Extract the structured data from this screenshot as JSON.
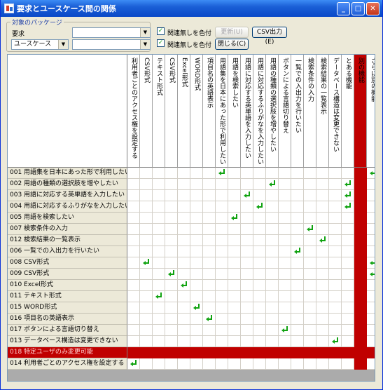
{
  "window": {
    "title": "要求とユースケース間の関係"
  },
  "filter": {
    "group_label": "対象のパッケージ",
    "req_label": "要求",
    "type_value": "ユースケース",
    "combo1_value": "",
    "combo2_value": ""
  },
  "options": {
    "chk1_label": "関連無しを色付",
    "chk2_label": "関連無しを色付",
    "chk1_checked": true,
    "chk2_checked": true
  },
  "buttons": {
    "update": "更新(U)",
    "csv": "CSV出力(E)",
    "close": "閉じる(C)"
  },
  "columns": [
    {
      "label": "利用者ごとのアクセス権を設定する",
      "red": false
    },
    {
      "label": "CSV形式",
      "red": false
    },
    {
      "label": "テキスト形式",
      "red": false
    },
    {
      "label": "CSV形式",
      "red": false
    },
    {
      "label": "Excel形式",
      "red": false
    },
    {
      "label": "WORD形式",
      "red": false
    },
    {
      "label": "項目名の英語表示",
      "red": false
    },
    {
      "label": "用語集を日本にあった形で利用したい",
      "red": false
    },
    {
      "label": "用語を検索したい",
      "red": false
    },
    {
      "label": "用語に対応する英単語を入力したい",
      "red": false
    },
    {
      "label": "用語に対応するふりがなを入力したい",
      "red": false
    },
    {
      "label": "用語の種類の選択肢を増やしたい",
      "red": false
    },
    {
      "label": "ボタンによる言語切り替え",
      "red": false
    },
    {
      "label": "一覧での入出力を行いたい",
      "red": false
    },
    {
      "label": "検索条件の入力",
      "red": false
    },
    {
      "label": "検索結果の一覧表示",
      "red": false
    },
    {
      "label": "データベース構造は変更できない",
      "red": false
    },
    {
      "label": "とある機能",
      "red": false
    },
    {
      "label": "別の機能",
      "red": true
    },
    {
      "label": "さらに別の機能",
      "red": false
    }
  ],
  "rows": [
    {
      "label": "001 用語集を日本にあった形で利用したい",
      "red": false,
      "marks": [
        7,
        19
      ]
    },
    {
      "label": "002 用語の種類の選択肢を増やしたい",
      "red": false,
      "marks": [
        11,
        17
      ]
    },
    {
      "label": "003 用語に対応する英単語を入力したい",
      "red": false,
      "marks": [
        9,
        17
      ]
    },
    {
      "label": "004 用語に対応するふりがなを入力したい",
      "red": false,
      "marks": [
        10,
        17
      ]
    },
    {
      "label": "005 用語を検索したい",
      "red": false,
      "marks": [
        8
      ]
    },
    {
      "label": "007 検索条件の入力",
      "red": false,
      "marks": [
        14
      ]
    },
    {
      "label": "012 検索結果の一覧表示",
      "red": false,
      "marks": [
        15
      ]
    },
    {
      "label": "006 一覧での入出力を行いたい",
      "red": false,
      "marks": [
        13
      ]
    },
    {
      "label": "008 CSV形式",
      "red": false,
      "marks": [
        1,
        19
      ]
    },
    {
      "label": "009 CSV形式",
      "red": false,
      "marks": [
        3,
        19
      ]
    },
    {
      "label": "010 Excel形式",
      "red": false,
      "marks": [
        4
      ]
    },
    {
      "label": "011 テキスト形式",
      "red": false,
      "marks": [
        2
      ]
    },
    {
      "label": "015 WORD形式",
      "red": false,
      "marks": [
        5
      ]
    },
    {
      "label": "016 項目名の英語表示",
      "red": false,
      "marks": [
        6
      ]
    },
    {
      "label": "017 ボタンによる言語切り替え",
      "red": false,
      "marks": [
        12
      ]
    },
    {
      "label": "013 データベース構造は変更できない",
      "red": false,
      "marks": [
        16
      ]
    },
    {
      "label": "018 特定ユーザのみ変更可能",
      "red": true,
      "marks": []
    },
    {
      "label": "014 利用者ごとのアクセス権を設定する",
      "red": false,
      "marks": [
        0
      ]
    }
  ]
}
